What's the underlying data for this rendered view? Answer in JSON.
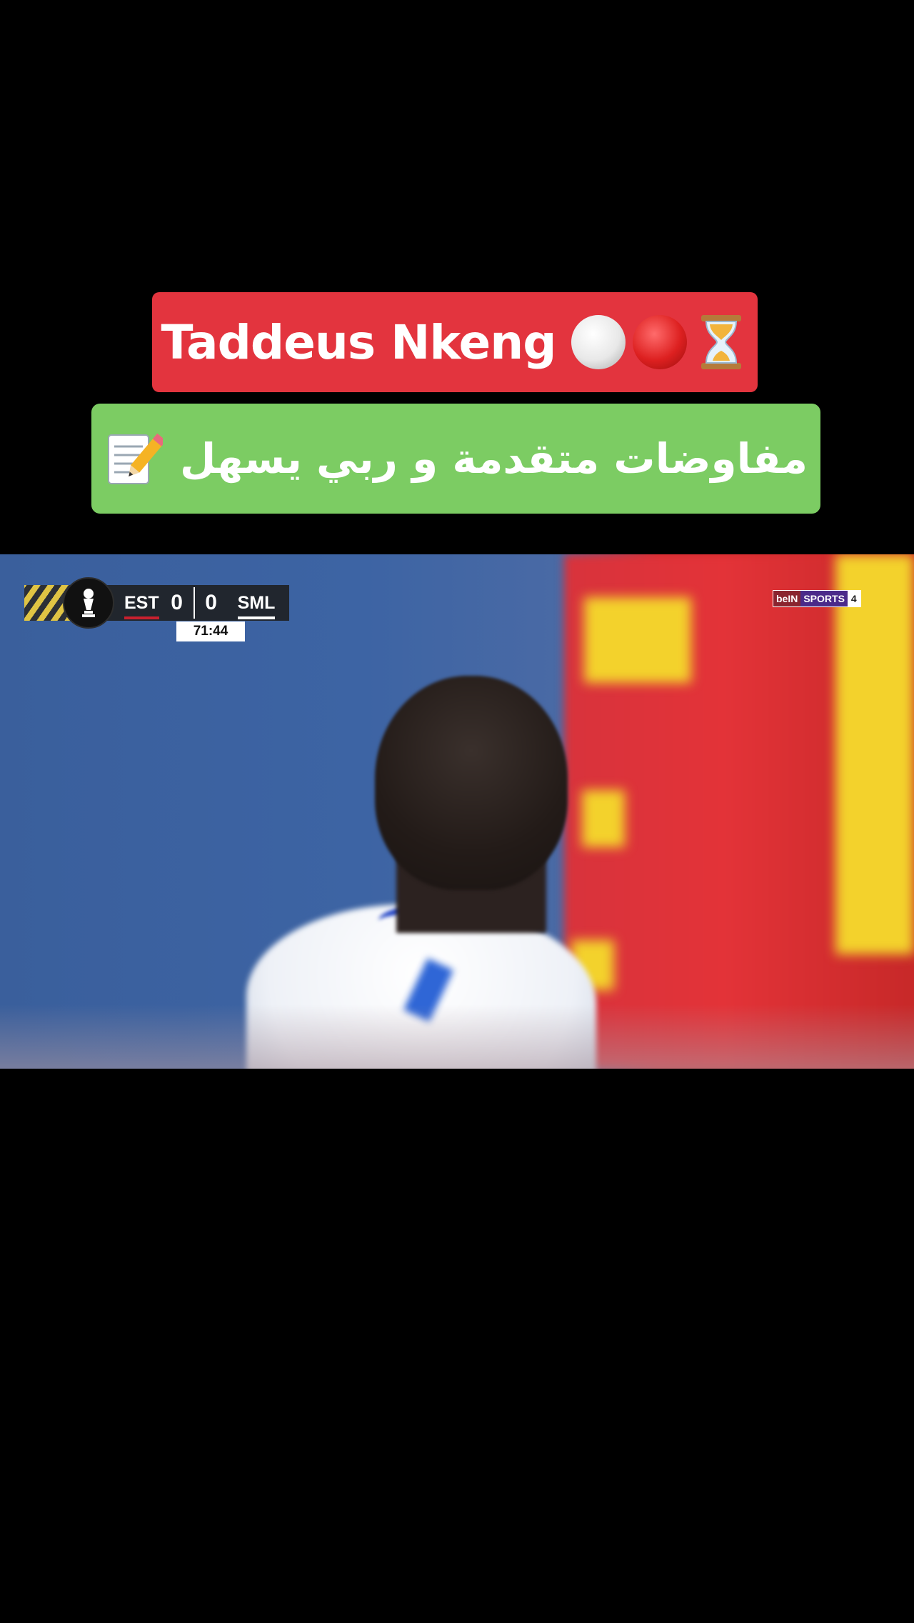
{
  "captions": {
    "name_caption": "Taddeus Nkeng",
    "name_caption_emojis": [
      "white-circle-icon",
      "red-circle-icon",
      "hourglass-icon"
    ],
    "status_caption": "مفاوضات متقدمة و ربي يسهل",
    "status_caption_emoji": "memo-icon"
  },
  "scoreboard": {
    "home_team": "EST",
    "home_score": "0",
    "away_score": "0",
    "away_team": "SML",
    "match_clock": "71:44",
    "home_color": "#c8202e",
    "away_color": "#ffffff"
  },
  "broadcaster": {
    "brand": "beIN",
    "product": "SPORTS",
    "channel": "4"
  },
  "colors": {
    "name_caption_bg": "#e3343e",
    "status_caption_bg": "#7ccc63",
    "background": "#000000"
  }
}
